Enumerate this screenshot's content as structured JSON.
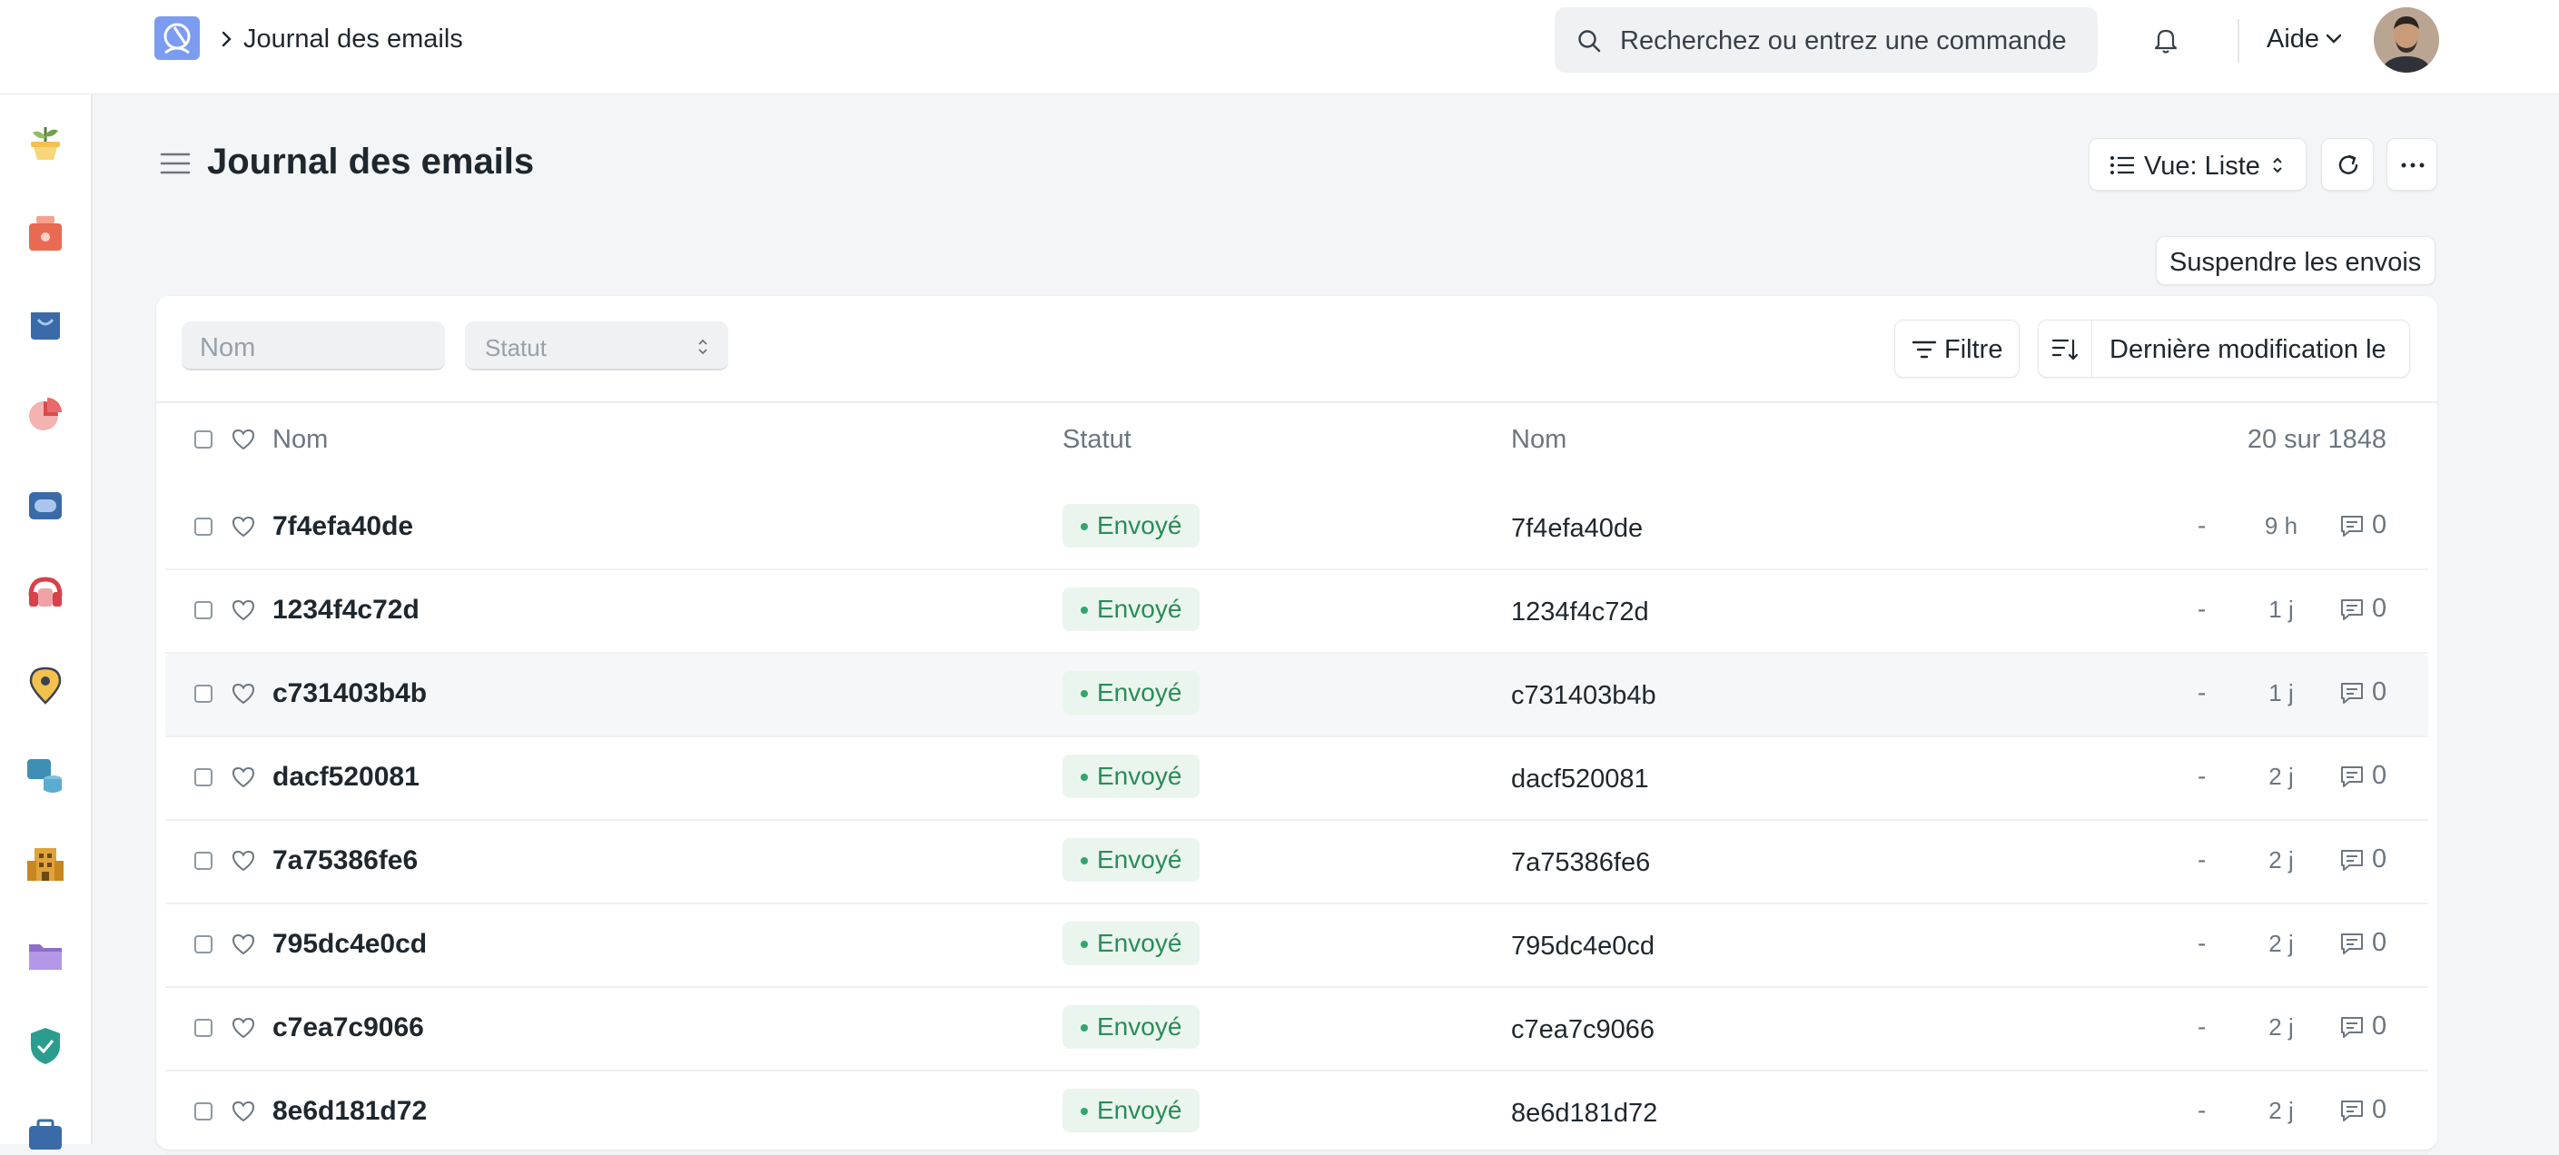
{
  "app": {
    "breadcrumb": "Journal des emails",
    "search_placeholder": "Recherchez ou entrez une commande",
    "help_label": "Aide"
  },
  "sidebar": {
    "icons": [
      "plant-pot-icon",
      "cash-register-icon",
      "shopping-bag-icon",
      "pie-chart-icon",
      "inbox-tray-icon",
      "support-headset-icon",
      "map-pin-icon",
      "database-stack-icon",
      "building-icon",
      "folder-icon",
      "shield-check-icon",
      "briefcase-icon"
    ]
  },
  "page": {
    "title": "Journal des emails",
    "view_label": "Vue: Liste",
    "suspend_label": "Suspendre les envois"
  },
  "filters": {
    "name_placeholder": "Nom",
    "status_placeholder": "Statut",
    "filter_label": "Filtre",
    "sort_label": "Dernière modification le"
  },
  "table": {
    "columns": {
      "name": "Nom",
      "status": "Statut",
      "name2": "Nom"
    },
    "count": "20 sur 1848",
    "rows": [
      {
        "name": "7f4efa40de",
        "status": "Envoyé",
        "name2": "7f4efa40de",
        "dash": "-",
        "age": "9 h",
        "comments": "0"
      },
      {
        "name": "1234f4c72d",
        "status": "Envoyé",
        "name2": "1234f4c72d",
        "dash": "-",
        "age": "1 j",
        "comments": "0"
      },
      {
        "name": "c731403b4b",
        "status": "Envoyé",
        "name2": "c731403b4b",
        "dash": "-",
        "age": "1 j",
        "comments": "0"
      },
      {
        "name": "dacf520081",
        "status": "Envoyé",
        "name2": "dacf520081",
        "dash": "-",
        "age": "2 j",
        "comments": "0"
      },
      {
        "name": "7a75386fe6",
        "status": "Envoyé",
        "name2": "7a75386fe6",
        "dash": "-",
        "age": "2 j",
        "comments": "0"
      },
      {
        "name": "795dc4e0cd",
        "status": "Envoyé",
        "name2": "795dc4e0cd",
        "dash": "-",
        "age": "2 j",
        "comments": "0"
      },
      {
        "name": "c7ea7c9066",
        "status": "Envoyé",
        "name2": "c7ea7c9066",
        "dash": "-",
        "age": "2 j",
        "comments": "0"
      },
      {
        "name": "8e6d181d72",
        "status": "Envoyé",
        "name2": "8e6d181d72",
        "dash": "-",
        "age": "2 j",
        "comments": "0"
      }
    ]
  }
}
